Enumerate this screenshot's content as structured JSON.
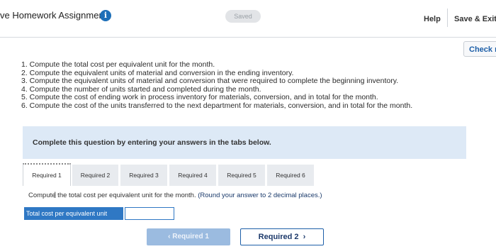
{
  "header": {
    "title": "ve Homework Assignment",
    "info_icon": "i",
    "saved": "Saved",
    "help": "Help",
    "save_exit": "Save & Exit",
    "check": "Check m"
  },
  "instructions": [
    "1. Compute the total cost per equivalent unit for the month.",
    "2. Compute the equivalent units of material and conversion in the ending inventory.",
    "3. Compute the equivalent units of material and conversion that were required to complete the beginning inventory.",
    "4. Compute the number of units started and completed during the month.",
    "5. Compute the cost of ending work in process inventory for materials, conversion, and in total for the month.",
    "6. Compute the cost of the units transferred to the next department for materials, conversion, and in total for the month."
  ],
  "panel": {
    "text": "Complete this question by entering your answers in the tabs below."
  },
  "tabs": [
    "Required 1",
    "Required 2",
    "Required 3",
    "Required 4",
    "Required 5",
    "Required 6"
  ],
  "question": {
    "text": "Compute the total cost per equivalent unit for the month.",
    "hint": "(Round your answer to 2 decimal places.)"
  },
  "answer": {
    "label": "Total cost per equivalent unit",
    "value": ""
  },
  "nav": {
    "prev": "Required 1",
    "next": "Required 2"
  }
}
